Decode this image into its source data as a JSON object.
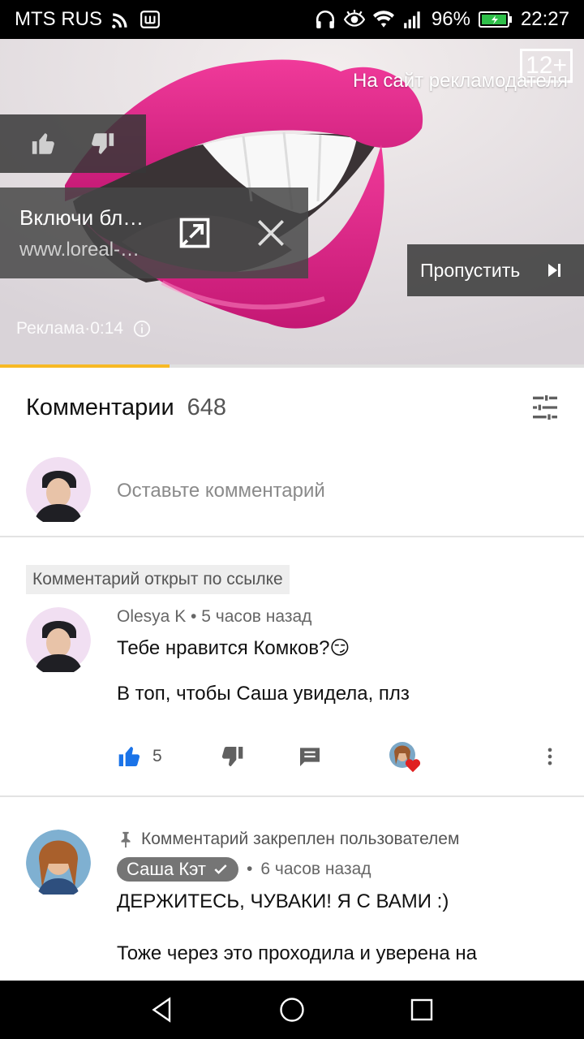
{
  "status_bar": {
    "carrier": "MTS RUS",
    "battery": "96%",
    "time": "22:27",
    "icons": [
      "wifi-calling-icon",
      "notification-app-icon",
      "headphones-icon",
      "eye-icon",
      "wifi-icon",
      "signal-icon",
      "battery-icon"
    ]
  },
  "video": {
    "age_rating": "12+",
    "advertiser_link": "На сайт рекламодателя",
    "ad_title": "Включи бл…",
    "ad_url": "www.loreal-…",
    "skip_label": "Пропустить",
    "ad_label": "Реклама·0:14",
    "ad_progress": 0.29,
    "colors": {
      "accent": "#f7b924",
      "lips": "#e0278a"
    }
  },
  "comments": {
    "title": "Комментарии",
    "count": "648",
    "placeholder": "Оставьте комментарий",
    "linked_badge": "Комментарий открыт по ссылке",
    "items": [
      {
        "author": "Olesya K",
        "time": "5 часов назад",
        "line1": "Тебе нравится Комков?",
        "emoji": "😏",
        "line2": "В топ, чтобы Саша увидела, плз",
        "likes": "5"
      },
      {
        "pinned_note": "Комментарий закреплен пользователем",
        "author": "Саша Кэт",
        "time": "6 часов назад",
        "line1": "ДЕРЖИТЕСЬ, ЧУВАКИ! Я С ВАМИ :)",
        "line2": "Тоже через это проходила и уверена на"
      }
    ]
  },
  "nav_bar": {
    "icons": [
      "back-icon",
      "home-icon",
      "recents-icon"
    ]
  }
}
